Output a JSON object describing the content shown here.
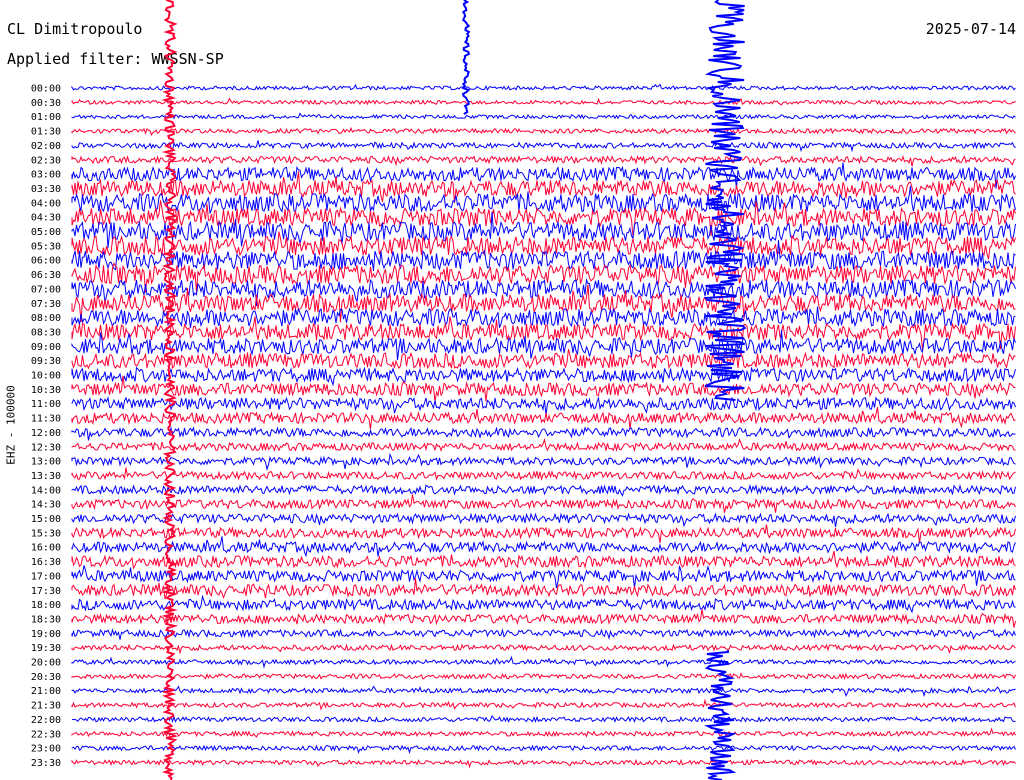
{
  "header": {
    "station": "CL Dimitropoulo",
    "date": "2025-07-14",
    "filter_text": "Applied filter: WWSSN-SP"
  },
  "chart_data": {
    "type": "line",
    "title": "CL Dimitropoulo",
    "ylabel": "EHZ - 100000",
    "row_labels": [
      "00:00",
      "00:30",
      "01:00",
      "01:30",
      "02:00",
      "02:30",
      "03:00",
      "03:30",
      "04:00",
      "04:30",
      "05:00",
      "05:30",
      "06:00",
      "06:30",
      "07:00",
      "07:30",
      "08:00",
      "08:30",
      "09:00",
      "09:30",
      "10:00",
      "10:30",
      "11:00",
      "11:30",
      "12:00",
      "12:30",
      "13:00",
      "13:30",
      "14:00",
      "14:30",
      "15:00",
      "15:30",
      "16:00",
      "16:30",
      "17:00",
      "17:30",
      "18:00",
      "18:30",
      "19:00",
      "19:30",
      "20:00",
      "20:30",
      "21:00",
      "21:30",
      "22:00",
      "22:30",
      "23:00",
      "23:30"
    ],
    "row_colors": [
      "#0000ff",
      "#ff0033"
    ],
    "relative_noise_amplitude": [
      0.25,
      0.25,
      0.25,
      0.3,
      0.35,
      0.45,
      0.9,
      1.1,
      1.2,
      1.2,
      1.25,
      1.25,
      1.25,
      1.25,
      1.2,
      1.2,
      1.15,
      1.1,
      1.05,
      1.0,
      0.9,
      0.85,
      0.8,
      0.7,
      0.6,
      0.5,
      0.5,
      0.5,
      0.55,
      0.6,
      0.6,
      0.65,
      0.7,
      0.75,
      0.75,
      0.75,
      0.7,
      0.6,
      0.45,
      0.35,
      0.3,
      0.3,
      0.3,
      0.3,
      0.3,
      0.3,
      0.3,
      0.3
    ],
    "time_axis_minutes": [
      0,
      30
    ]
  }
}
